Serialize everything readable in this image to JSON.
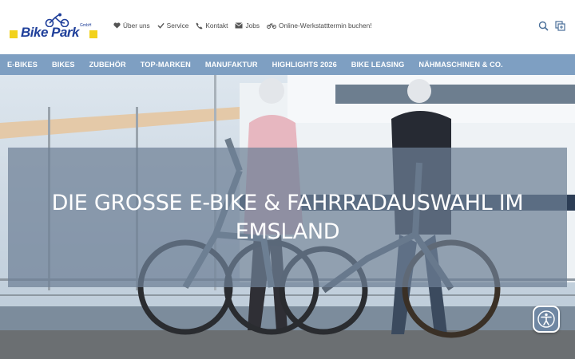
{
  "logo": {
    "text": "Bike Park",
    "tagline": "GmbH"
  },
  "top_links": [
    {
      "label": "Über uns",
      "icon": "heart-icon"
    },
    {
      "label": "Service",
      "icon": "check-icon"
    },
    {
      "label": "Kontakt",
      "icon": "phone-icon"
    },
    {
      "label": "Jobs",
      "icon": "mail-icon"
    },
    {
      "label": "Online-Werkstatttermin buchen!",
      "icon": "bicycle-icon"
    }
  ],
  "header_icons": [
    "search-icon",
    "compare-icon"
  ],
  "main_nav": [
    "E-BIKES",
    "BIKES",
    "ZUBEHÖR",
    "TOP-MARKEN",
    "MANUFAKTUR",
    "HIGHLIGHTS 2026",
    "BIKE LEASING",
    "NÄHMASCHINEN & CO."
  ],
  "hero": {
    "headline": "DIE GROSSE E-BIKE & FAHRRADAUSWAHL IM EMSLAND"
  },
  "colors": {
    "nav_bg": "#7e9fc2",
    "logo_blue": "#1f3f9a",
    "logo_yellow": "#f2d21c",
    "banner_overlay": "rgba(110,128,150,0.72)"
  },
  "accessibility_button": {
    "icon": "accessibility-icon"
  }
}
